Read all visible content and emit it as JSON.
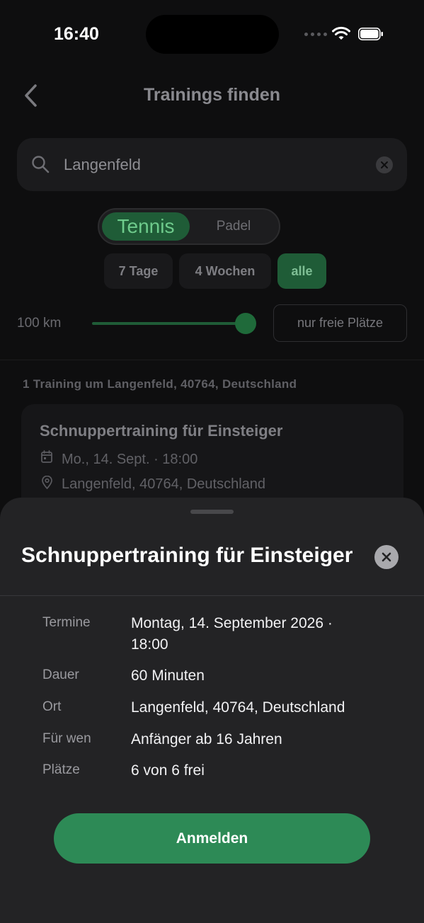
{
  "status_bar": {
    "time": "16:40"
  },
  "header": {
    "title": "Trainings finden"
  },
  "search": {
    "value": "Langenfeld"
  },
  "sport_toggle": {
    "options": [
      "Tennis",
      "Padel"
    ],
    "selected": "Tennis"
  },
  "range_chips": {
    "items": [
      "7 Tage",
      "4 Wochen",
      "alle"
    ],
    "selected": "alle"
  },
  "distance": {
    "label": "100 km",
    "value_fraction": 1.0
  },
  "filter": {
    "free_only_label": "nur freie Plätze"
  },
  "results": {
    "summary": "1 Training um Langenfeld, 40764, Deutschland"
  },
  "card": {
    "title": "Schnuppertraining für Einsteiger",
    "date": "Mo., 14. Sept. · 18:00",
    "location": "Langenfeld, 40764, Deutschland"
  },
  "sheet": {
    "title": "Schnuppertraining für Einsteiger",
    "rows": [
      {
        "label": "Termine",
        "value": "Montag, 14. September 2026 · 18:00"
      },
      {
        "label": "Dauer",
        "value": "60 Minuten"
      },
      {
        "label": "Ort",
        "value": "Langenfeld, 40764, Deutschland"
      },
      {
        "label": "Für wen",
        "value": "Anfänger ab 16 Jahren"
      },
      {
        "label": "Plätze",
        "value": "6 von 6 frei"
      }
    ],
    "cta_label": "Anmelden"
  },
  "colors": {
    "accent": "#2d8a56",
    "accent_dim": "#1f5c37",
    "background": "#0e0e0f",
    "sheet": "#232325"
  }
}
